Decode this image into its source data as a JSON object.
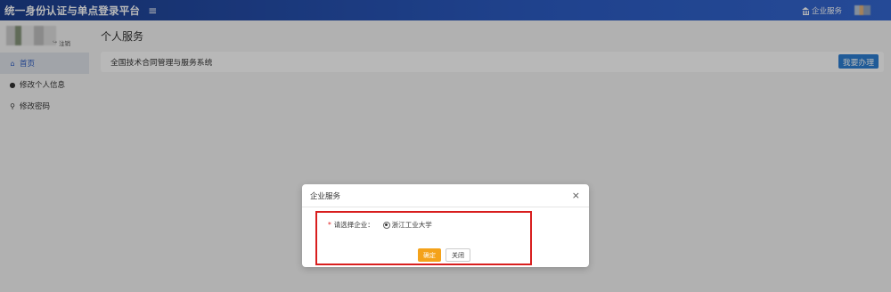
{
  "header": {
    "title": "统一身份认证与单点登录平台",
    "menu_toggle": "≡",
    "enterprise_link": "企业服务"
  },
  "sidebar": {
    "logout": "注销",
    "items": [
      {
        "label": "首页",
        "icon": "home-icon",
        "glyph": "🏠"
      },
      {
        "label": "修改个人信息",
        "icon": "user-icon",
        "glyph": "👤"
      },
      {
        "label": "修改密码",
        "icon": "key-icon",
        "glyph": "🔑"
      }
    ]
  },
  "main": {
    "page_title": "个人服务",
    "services": [
      {
        "name": "全国技术合同管理与服务系统",
        "action_label": "我要办理"
      }
    ]
  },
  "modal": {
    "title": "企业服务",
    "close_glyph": "×",
    "required_mark": "*",
    "field_label": "请选择企业：",
    "option": "浙江工业大学",
    "ok_label": "确定",
    "close_label": "关闭"
  },
  "colors": {
    "header_start": "#1d3f8f",
    "header_end": "#3467d1",
    "primary_button": "#2d7fd3",
    "ok_button": "#f4a21a",
    "highlight": "#d81e1e"
  }
}
